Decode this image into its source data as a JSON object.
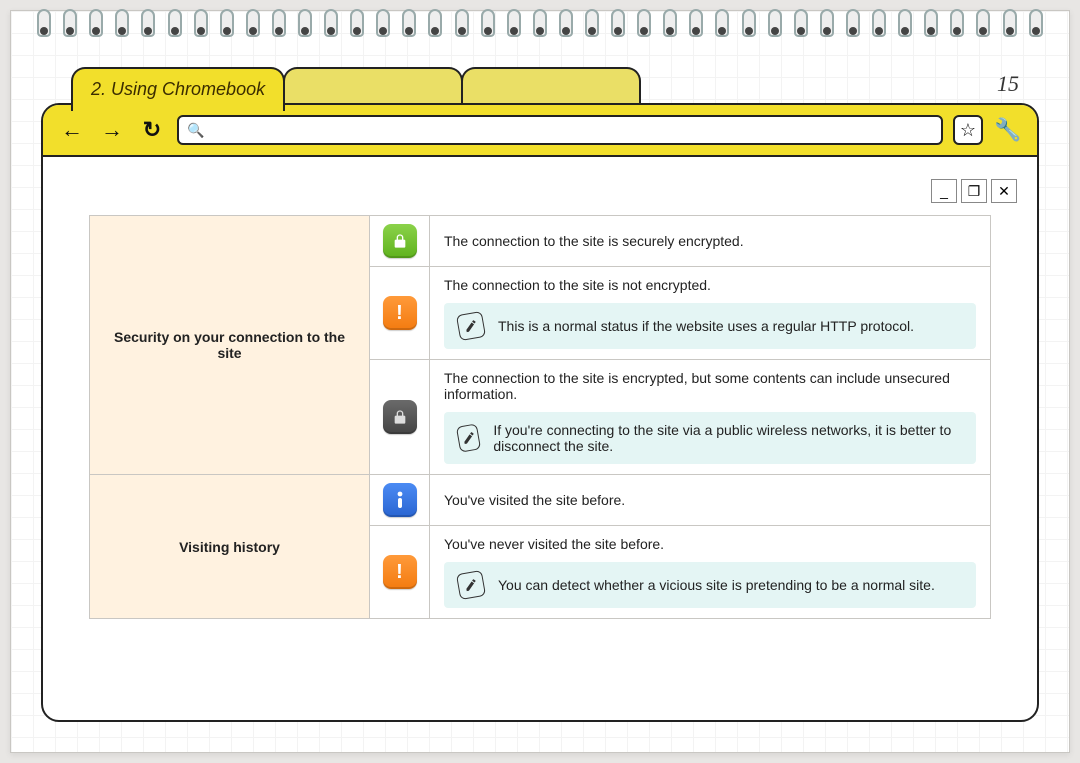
{
  "page": {
    "chapter_title": "2. Using Chromebook",
    "page_number": "15"
  },
  "toolbar": {
    "back": "←",
    "forward": "→",
    "reload": "↻",
    "search": "🔍",
    "star": "☆",
    "wrench": "🔧"
  },
  "window_controls": {
    "minimize": "_",
    "maximize": "❐",
    "close": "✕"
  },
  "sections": {
    "security": {
      "label": "Security on your connection to the site",
      "rows": {
        "encrypted": {
          "icon": "lock-green",
          "text": "The connection to the site is securely encrypted."
        },
        "not_encrypted": {
          "icon": "warning-orange",
          "text": "The connection to the site is not encrypted.",
          "note": "This is a normal status if the website uses a regular HTTP protocol."
        },
        "mixed": {
          "icon": "lock-gray",
          "text": "The connection to the site is encrypted, but some contents can include unsecured information.",
          "note": "If you're connecting to the site via a public wireless networks, it is better to disconnect the site."
        }
      }
    },
    "history": {
      "label": "Visiting history",
      "rows": {
        "visited": {
          "icon": "info-blue",
          "text": "You've visited the site before."
        },
        "not_visited": {
          "icon": "warning-orange",
          "text": "You've never visited the site before.",
          "note": "You can detect whether a vicious site is pretending to be a normal site."
        }
      }
    }
  }
}
